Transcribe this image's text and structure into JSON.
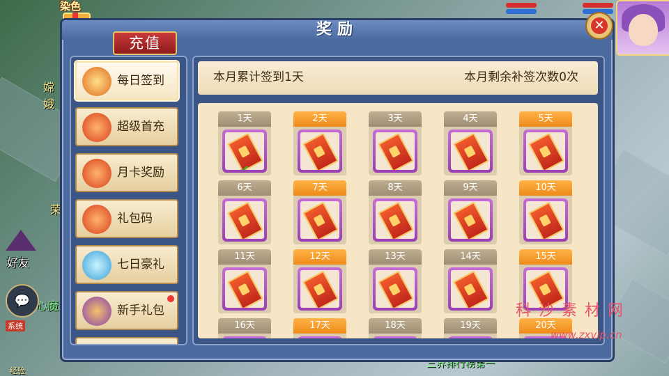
{
  "panel": {
    "title": "奖励",
    "recharge_tab": "充值",
    "close_icon": "✕"
  },
  "sidebar": {
    "items": [
      {
        "label": "每日签到",
        "icon": "coin-pouch-icon",
        "active": true,
        "dot": false
      },
      {
        "label": "超级首充",
        "icon": "money-bag-icon",
        "active": false,
        "dot": false
      },
      {
        "label": "月卡奖励",
        "icon": "money-bag-icon",
        "active": false,
        "dot": false
      },
      {
        "label": "礼包码",
        "icon": "money-bag-icon",
        "active": false,
        "dot": false
      },
      {
        "label": "七日豪礼",
        "icon": "jewel-bag-icon",
        "active": false,
        "dot": false
      },
      {
        "label": "新手礼包",
        "icon": "treasure-icon",
        "active": false,
        "dot": true
      }
    ]
  },
  "info": {
    "left": "本月累计签到1天",
    "right": "本月剩余补签次数0次"
  },
  "days": [
    {
      "label": "1天",
      "tab": "gray",
      "checked": true
    },
    {
      "label": "2天",
      "tab": "orange",
      "checked": false
    },
    {
      "label": "3天",
      "tab": "gray",
      "checked": false
    },
    {
      "label": "4天",
      "tab": "gray",
      "checked": false
    },
    {
      "label": "5天",
      "tab": "orange",
      "checked": false
    },
    {
      "label": "6天",
      "tab": "gray",
      "checked": false
    },
    {
      "label": "7天",
      "tab": "orange",
      "checked": false
    },
    {
      "label": "8天",
      "tab": "gray",
      "checked": false
    },
    {
      "label": "9天",
      "tab": "gray",
      "checked": false
    },
    {
      "label": "10天",
      "tab": "orange",
      "checked": false
    },
    {
      "label": "11天",
      "tab": "gray",
      "checked": false
    },
    {
      "label": "12天",
      "tab": "orange",
      "checked": false
    },
    {
      "label": "13天",
      "tab": "gray",
      "checked": false
    },
    {
      "label": "14天",
      "tab": "gray",
      "checked": false
    },
    {
      "label": "15天",
      "tab": "orange",
      "checked": false
    },
    {
      "label": "16天",
      "tab": "gray",
      "checked": false
    },
    {
      "label": "17天",
      "tab": "orange",
      "checked": false
    },
    {
      "label": "18天",
      "tab": "gray",
      "checked": false
    },
    {
      "label": "19天",
      "tab": "gray",
      "checked": false
    },
    {
      "label": "20天",
      "tab": "orange",
      "checked": false
    }
  ],
  "hud": {
    "dye_label": "染色",
    "friend_label": "好友",
    "chat_icon": "chat-bubble-icon",
    "system_badge": "系统",
    "bottom_center": "三界排行榜第一",
    "bottom_left": "经验",
    "left_texts": [
      "嫦娥",
      "荣",
      "心魔"
    ]
  },
  "watermark": {
    "line1": "科 沙 素 材 网",
    "line2": "www.zxvip.cn"
  },
  "colors": {
    "accent_orange": "#ee8a1a",
    "tab_gray": "#9f8e73",
    "frame_purple": "#9b3fb5",
    "panel_blue": "#4b6aa0"
  }
}
